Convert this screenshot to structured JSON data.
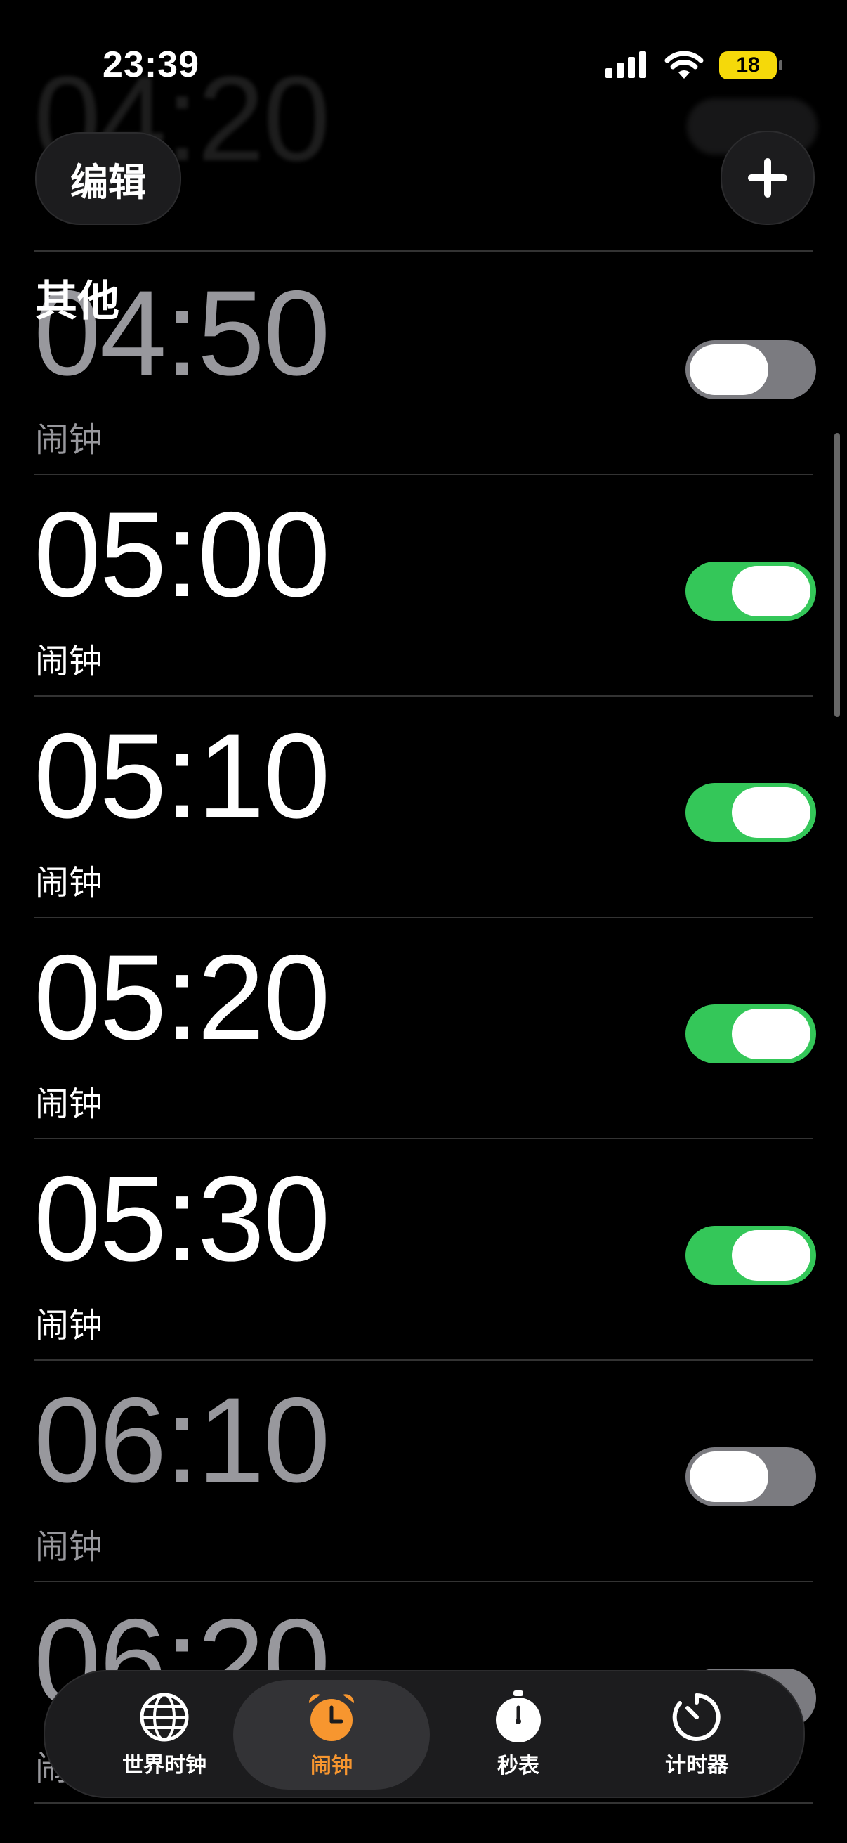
{
  "status_bar": {
    "time": "23:39",
    "battery": "18"
  },
  "header": {
    "edit_label": "编辑",
    "title": "",
    "ghost_time": "04:20"
  },
  "section": {
    "label": "其他"
  },
  "alarms": [
    {
      "time": "04:50",
      "label": "闹钟",
      "enabled": false
    },
    {
      "time": "05:00",
      "label": "闹钟",
      "enabled": true
    },
    {
      "time": "05:10",
      "label": "闹钟",
      "enabled": true
    },
    {
      "time": "05:20",
      "label": "闹钟",
      "enabled": true
    },
    {
      "time": "05:30",
      "label": "闹钟",
      "enabled": true
    },
    {
      "time": "06:10",
      "label": "闹钟",
      "enabled": false
    },
    {
      "time": "06:20",
      "label": "闹钟",
      "enabled": false
    }
  ],
  "tabs": [
    {
      "label": "世界时钟",
      "icon": "globe-icon",
      "active": false
    },
    {
      "label": "闹钟",
      "icon": "alarm-clock-icon",
      "active": true
    },
    {
      "label": "秒表",
      "icon": "stopwatch-icon",
      "active": false
    },
    {
      "label": "计时器",
      "icon": "timer-icon",
      "active": false
    }
  ],
  "colors": {
    "accent": "#f7962f",
    "toggle_on": "#34c759",
    "toggle_off": "#7b7b80"
  }
}
